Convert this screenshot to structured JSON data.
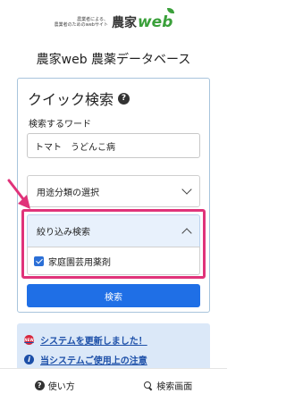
{
  "header": {
    "tagline_1": "農業者による、",
    "tagline_2": "農業者のためのwebサイト",
    "logo_kanji": "農家",
    "logo_web": "web"
  },
  "page_title": "農家web 農薬データベース",
  "quick_search": {
    "title": "クイック検索",
    "help_icon": "?",
    "keyword_label": "検索するワード",
    "keyword_value": "トマト　うどんこ病",
    "category_dropdown": "用途分類の選択",
    "filter_label": "絞り込み検索",
    "filter_option": "家庭園芸用薬剤",
    "filter_option_checked": true,
    "search_button": "検索"
  },
  "notices": {
    "new_badge": "NEW",
    "update_link": "システムを更新しました！",
    "info_icon": "i",
    "usage_link": "当システムご使用上の注意"
  },
  "bottom_nav": {
    "help_tab": "使い方",
    "search_tab": "検索画面"
  },
  "colors": {
    "primary": "#1f6fe6",
    "highlight": "#e0337a",
    "logo_green": "#3aa03a"
  }
}
